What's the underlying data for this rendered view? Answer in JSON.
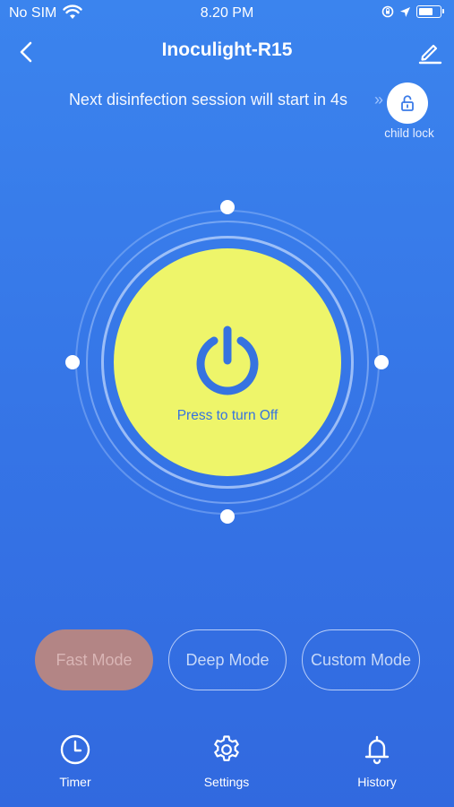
{
  "status_bar": {
    "carrier": "No SIM",
    "time": "8.20 PM"
  },
  "header": {
    "title": "Inoculight-R15"
  },
  "banner": {
    "text": "Next disinfection session will start in 4s",
    "child_lock_label": "child lock"
  },
  "power": {
    "label": "Press to turn Off",
    "circle_color": "#eef56a",
    "icon_color": "#3673e0"
  },
  "modes": [
    {
      "label": "Fast Mode",
      "selected": true
    },
    {
      "label": "Deep Mode",
      "selected": false
    },
    {
      "label": "Custom Mode",
      "selected": false
    }
  ],
  "tabs": [
    {
      "label": "Timer",
      "icon": "clock-icon"
    },
    {
      "label": "Settings",
      "icon": "gear-icon"
    },
    {
      "label": "History",
      "icon": "bell-icon"
    }
  ]
}
